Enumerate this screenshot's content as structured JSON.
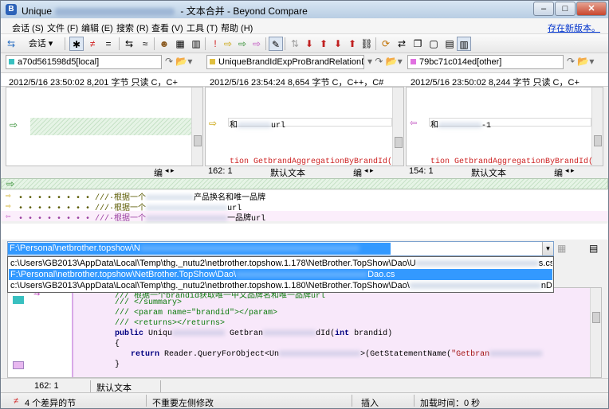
{
  "window": {
    "title_prefix": "Unique",
    "title_suffix": " - 文本合并 - Beyond Compare",
    "btn_min": "–",
    "btn_max": "□",
    "btn_close": "✕"
  },
  "menu": {
    "items": [
      "会话 (S)",
      "文件 (F)",
      "编辑 (E)",
      "搜索 (R)",
      "查看 (V)",
      "工具 (T)",
      "帮助 (H)"
    ],
    "link": "存在新版本。"
  },
  "toolbar": {
    "session_label": "会话"
  },
  "paths": {
    "left": "a70d561598d5[local]",
    "center": "UniqueBrandIdExpProBrandRelationD",
    "right": "79bc71c014ed[other]",
    "left_color": "#39c0c0",
    "center_color": "#e0c040",
    "right_color": "#e070e0"
  },
  "info": {
    "left": "2012/5/16 23:50:02    8,201 字节    只读    C，C+",
    "center": "2012/5/16 23:54:24    8,654 字节    C，C++，C#",
    "right": "2012/5/16 23:50:02    8,244 字节    只读    C，C+"
  },
  "panes": {
    "center_line1": "和",
    "center_line1_tail": "url",
    "center_line2": "tion GetbrandAggregationByBrandId(int",
    "right_line1": "和",
    "right_line1_tail": "-1",
    "right_line2": "tion GetbrandAggregationByBrandId(int"
  },
  "pane_status": {
    "left_edit": "编",
    "center_pos": "162: 1",
    "center_mode": "默认文本",
    "center_edit": "编",
    "right_pos": "154: 1",
    "right_mode": "默认文本",
    "right_edit": "编"
  },
  "summary": {
    "line1": "• • • • • • • • ///·根据一个",
    "line1_tail": "产品换名和唯一品牌",
    "line2": "• • • • • • • • ///·根据一个",
    "line2_tail": "url",
    "line3": "• • • • • • • • ///·根据一个",
    "line3_tail": "一品牌url"
  },
  "combo": {
    "value": "F:\\Personal\\netbrother.topshow\\N"
  },
  "dropdown": {
    "items": [
      "c:\\Users\\GB2013\\AppData\\Local\\Temp\\thg._nutu2\\netbrother.topshow.1.178\\NetBrother.TopShow\\Dao\\U",
      "F:\\Personal\\netbrother.topshow\\NetBrother.TopShow\\Dao\\",
      "c:\\Users\\GB2013\\AppData\\Local\\Temp\\thg._nutu2\\netbrother.topshow.1.180\\NetBrother.TopShow\\Dao\\"
    ],
    "tails": [
      "s.cs",
      "Dao.cs",
      "nDao.cs"
    ]
  },
  "code": {
    "line1": "/// 根据一个brandid获取唯一中文品牌名和唯一品牌url",
    "line2": "/// </summary>",
    "line3": "/// <param name=\"brandid\"></param>",
    "line4": "/// <returns></returns>",
    "line5_kw": "public",
    "line5_a": " Uniqu",
    "line5_b": " Getbran",
    "line5_c": "dId(",
    "line5_kw2": "int",
    "line5_d": " brandid)",
    "line6": "{",
    "line7_kw": "return",
    "line7_a": " Reader.QueryForObject<Un",
    "line7_b": ">(GetStatementName(",
    "line7_str": "\"Getbran",
    "line8": "}"
  },
  "lower_status": {
    "pos": "162: 1",
    "mode": "默认文本"
  },
  "statusbar": {
    "diff_count": "4 个差异的节",
    "unimportant": "不重要左侧修改",
    "insert": "插入",
    "load_time": "加载时间：0 秒"
  }
}
